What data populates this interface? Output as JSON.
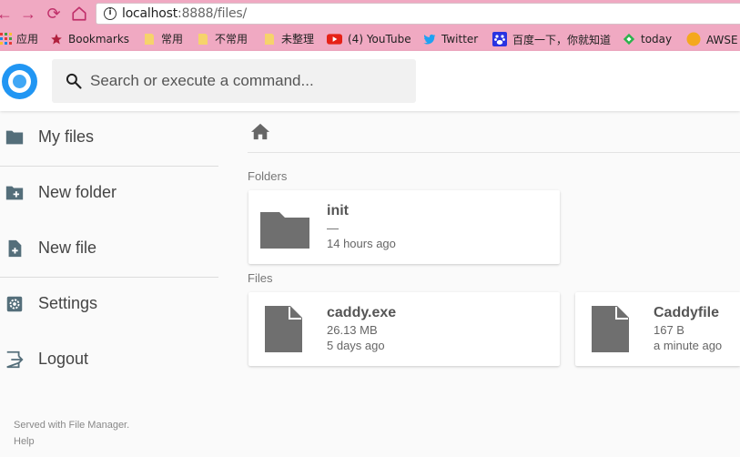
{
  "browser": {
    "url_host": "localhost",
    "url_path": ":8888/files/",
    "nav_back_glyph": "←",
    "nav_forward_glyph": "→",
    "nav_reload_glyph": "⟳",
    "info_glyph": "i"
  },
  "bookmarks": [
    {
      "label": "应用",
      "icon": "apps-grid-icon"
    },
    {
      "label": "Bookmarks",
      "icon": "star-icon"
    },
    {
      "label": "常用",
      "icon": "folder-icon"
    },
    {
      "label": "不常用",
      "icon": "folder-icon"
    },
    {
      "label": "未整理",
      "icon": "folder-icon"
    },
    {
      "label": "(4) YouTube",
      "icon": "youtube-icon"
    },
    {
      "label": "Twitter",
      "icon": "twitter-icon"
    },
    {
      "label": "百度一下，你就知道",
      "icon": "baidu-icon"
    },
    {
      "label": "today",
      "icon": "feedly-icon"
    },
    {
      "label": "AWSE",
      "icon": "awse-icon"
    }
  ],
  "header": {
    "search_placeholder": "Search or execute a command..."
  },
  "sidebar": {
    "items": [
      {
        "label": "My files",
        "icon": "folder-icon"
      },
      {
        "label": "New folder",
        "icon": "new-folder-icon"
      },
      {
        "label": "New file",
        "icon": "new-file-icon"
      },
      {
        "label": "Settings",
        "icon": "gear-icon"
      },
      {
        "label": "Logout",
        "icon": "logout-icon"
      }
    ],
    "footer_served": "Served with File Manager.",
    "footer_help": "Help"
  },
  "main": {
    "folders_title": "Folders",
    "files_title": "Files",
    "folders": [
      {
        "name": "init",
        "size": "—",
        "modified": "14 hours ago"
      }
    ],
    "files": [
      {
        "name": "caddy.exe",
        "size": "26.13 MB",
        "modified": "5 days ago"
      },
      {
        "name": "Caddyfile",
        "size": "167 B",
        "modified": "a minute ago"
      }
    ]
  },
  "colors": {
    "browser_chrome": "#f0a9c2",
    "accent": "#2196f3",
    "icon_gray": "#6f6f6f",
    "sidebar_icon": "#546e7a"
  }
}
